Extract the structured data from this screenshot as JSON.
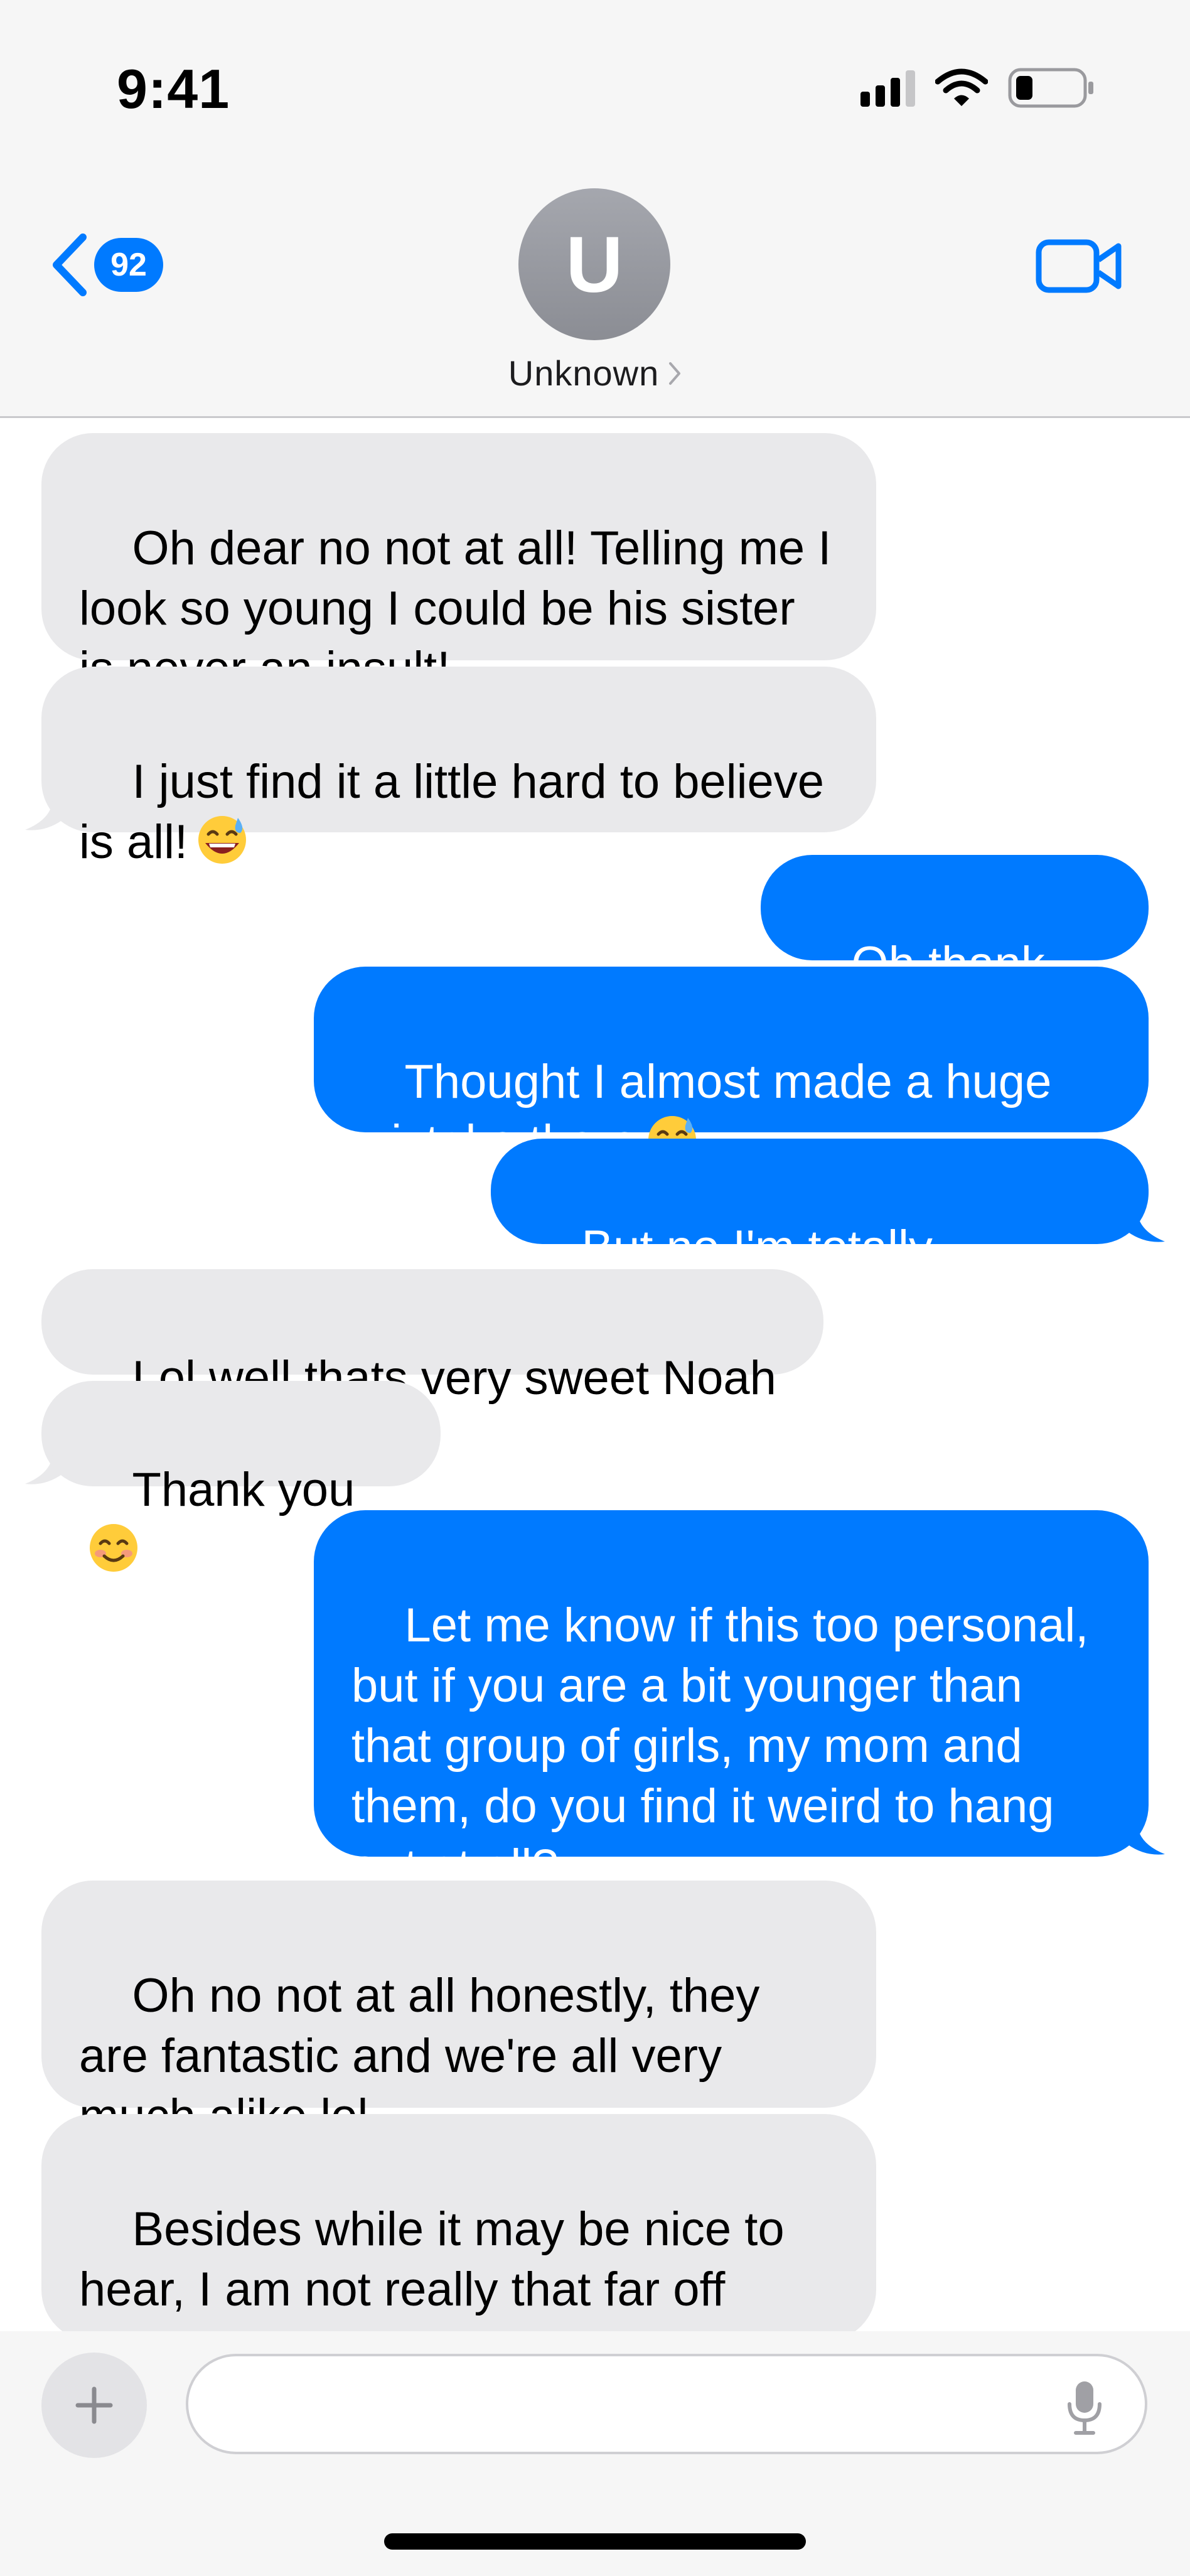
{
  "status_bar": {
    "time": "9:41",
    "signal_icon": "cellular-signal-icon",
    "wifi_icon": "wifi-icon",
    "battery_icon": "battery-low-icon"
  },
  "header": {
    "back_icon": "chevron-left-icon",
    "unread_count": "92",
    "avatar_initial": "U",
    "contact_name": "Unknown",
    "contact_chevron": ">",
    "video_icon": "video-camera-icon"
  },
  "colors": {
    "accent": "#007aff",
    "incoming_bubble": "#e9e9eb",
    "outgoing_bubble": "#007aff",
    "chrome_background": "#f6f6f6"
  },
  "messages": [
    {
      "direction": "incoming",
      "text": "Oh dear no not at all! Telling me I look so young I could be his sister is never an insult!"
    },
    {
      "direction": "incoming",
      "text": "I just find it a little hard to believe is all!",
      "emoji": "grinning-sweat-emoji"
    },
    {
      "direction": "outgoing",
      "text": "Oh thank god"
    },
    {
      "direction": "outgoing",
      "text": "Thought I almost made a huge mistake there",
      "emoji": "grinning-sweat-emoji"
    },
    {
      "direction": "outgoing",
      "text": "But no I'm totally serious!"
    },
    {
      "direction": "incoming",
      "text": "Lol well thats very sweet Noah"
    },
    {
      "direction": "incoming",
      "text": "Thank you",
      "emoji": "smiling-blush-emoji"
    },
    {
      "direction": "outgoing",
      "text": "Let me know if this too personal, but if you are a bit younger than that group of girls, my mom and them, do you find it weird to hang out at all?"
    },
    {
      "direction": "incoming",
      "text": "Oh no not at all honestly, they are fantastic and we're all very much alike lol"
    },
    {
      "direction": "incoming",
      "text": "Besides while it may be nice to hear, I am not really that far off haha"
    }
  ],
  "composer": {
    "plus_icon": "plus-icon",
    "placeholder": "",
    "mic_icon": "microphone-icon"
  }
}
